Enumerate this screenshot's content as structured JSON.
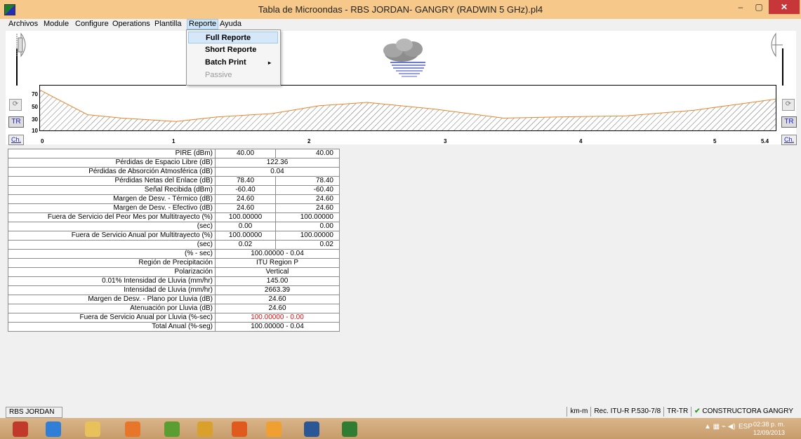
{
  "window": {
    "title": "Tabla de Microondas - RBS JORDAN-  GANGRY (RADWIN 5 GHz).pl4",
    "minimize_glyph": "–",
    "maximize_glyph": "▢",
    "close_glyph": "✕"
  },
  "menu": {
    "items": [
      "Archivos",
      "Module",
      "Configure",
      "Operations",
      "Plantilla",
      "Reporte",
      "Ayuda"
    ],
    "active": "Reporte"
  },
  "dropdown": {
    "items": [
      {
        "label": "Full Reporte",
        "highlighted": true,
        "enabled": true
      },
      {
        "label": "Short Reporte",
        "enabled": true
      },
      {
        "label": "Batch Print",
        "submenu": true,
        "enabled": true
      },
      {
        "label": "Passive",
        "enabled": false
      }
    ],
    "submenu_arrow": "▸"
  },
  "profile": {
    "y_ticks": [
      "70",
      "50",
      "30",
      "10"
    ],
    "x_ticks": [
      "0",
      "1",
      "2",
      "3",
      "4",
      "5",
      "5.4"
    ],
    "terrain_km": [
      0,
      0.35,
      0.6,
      1.0,
      1.3,
      1.7,
      2.05,
      2.4,
      2.9,
      3.4,
      3.8,
      4.3,
      4.8,
      5.1,
      5.4
    ],
    "terrain_height": [
      72,
      28,
      22,
      16,
      24,
      30,
      44,
      50,
      38,
      22,
      24,
      26,
      36,
      46,
      56
    ],
    "line_color": "#e8862a",
    "hatch_color": "#333333",
    "buttons": {
      "tr": "TR",
      "ch": "Ch."
    },
    "icons": [
      "antenna-icon",
      "rain-cloud-icon"
    ]
  },
  "results": {
    "rows": [
      {
        "label": "PIRE (dBm)",
        "v1": "40.00",
        "v2": "40.00"
      },
      {
        "label": "Pérdidas de Espacio Libre (dB)",
        "span": "122.36"
      },
      {
        "label": "Pérdidas de Absorción Atmosférica (dB)",
        "span": "0.04"
      },
      {
        "label": "Pérdidas Netas del Enlace (dB)",
        "v1": "78.40",
        "v2": "78.40"
      },
      {
        "label": "Señal Recibida (dBm)",
        "v1": "-60.40",
        "v2": "-60.40"
      },
      {
        "label": "Margen de Desv. - Térmico (dB)",
        "v1": "24.60",
        "v2": "24.60"
      },
      {
        "label": "Margen de Desv. - Efectivo (dB)",
        "v1": "24.60",
        "v2": "24.60"
      },
      {
        "label": "Fuera de Servicio del Peor Mes por Multitrayecto (%)",
        "v1": "100.00000",
        "v2": "100.00000"
      },
      {
        "label": "(sec)",
        "v1": "0.00",
        "v2": "0.00"
      },
      {
        "label": "Fuera de Servicio Anual por Multitrayecto (%)",
        "v1": "100.00000",
        "v2": "100.00000"
      },
      {
        "label": "(sec)",
        "v1": "0.02",
        "v2": "0.02"
      },
      {
        "label": "(% - sec)",
        "span": "100.00000 - 0.04"
      },
      {
        "label": "Región de Precipitación",
        "span": "ITU Region P"
      },
      {
        "label": "Polarización",
        "span": "Vertical"
      },
      {
        "label": "0.01% Intensidad de Lluvia (mm/hr)",
        "span": "145.00"
      },
      {
        "label": "Intensidad de Lluvia (mm/hr)",
        "span": "2663.39"
      },
      {
        "label": "Margen de Desv. - Plano por Lluvia (dB)",
        "span": "24.60"
      },
      {
        "label": "Atenuación por Lluvia (dB)",
        "span": "24.60"
      },
      {
        "label": "Fuera de Servicio Anual por Lluvia (%-sec)",
        "span": "100.00000 - 0.00",
        "red": true
      },
      {
        "label": "Total Anual (%-seg)",
        "span": "100.00000 - 0.04"
      }
    ]
  },
  "status": {
    "left": "RBS  JORDAN",
    "units": "km-m",
    "rec": "Rec. ITU-R P.530-7/8",
    "tr": "TR-TR",
    "company": "CONSTRUCTORA GANGRY"
  },
  "taskbar": {
    "apps": [
      {
        "name": "firefox-like-icon",
        "color": "#c0392b"
      },
      {
        "name": "internet-explorer-icon",
        "color": "#2f7fd8"
      },
      {
        "name": "file-explorer-icon",
        "color": "#e8c15a"
      },
      {
        "name": "office-icon",
        "color": "#e8762a"
      },
      {
        "name": "winamp-icon",
        "color": "#5a9e32"
      },
      {
        "name": "chrome-icon",
        "color": "#d9a12b"
      },
      {
        "name": "firefox-icon",
        "color": "#e05a1e"
      },
      {
        "name": "outlook-icon",
        "color": "#f0a030"
      },
      {
        "name": "word-icon",
        "color": "#2b5797"
      },
      {
        "name": "pathloss-icon",
        "color": "#2e7d32"
      }
    ],
    "tray_text": "ESP",
    "time": "02:38 p. m.",
    "date": "12/09/2013"
  }
}
